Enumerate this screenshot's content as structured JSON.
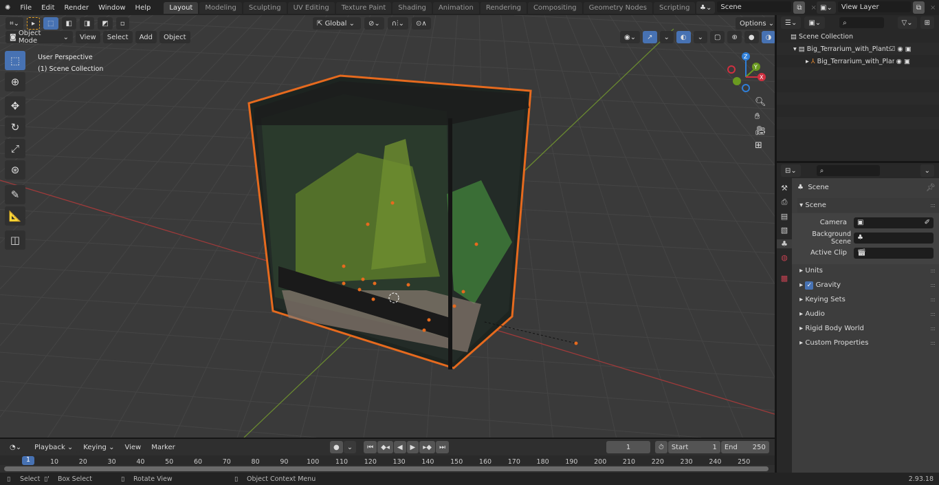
{
  "menu": [
    "File",
    "Edit",
    "Render",
    "Window",
    "Help"
  ],
  "workspaces": [
    "Layout",
    "Modeling",
    "Sculpting",
    "UV Editing",
    "Texture Paint",
    "Shading",
    "Animation",
    "Rendering",
    "Compositing",
    "Geometry Nodes",
    "Scripting"
  ],
  "active_workspace": "Layout",
  "scene_field": "Scene",
  "view_layer_field": "View Layer",
  "header": {
    "transform_orientation": "Global",
    "options": "Options",
    "mode": "Object Mode",
    "menus": [
      "View",
      "Select",
      "Add",
      "Object"
    ]
  },
  "viewport": {
    "perspective": "User Perspective",
    "collection": "(1) Scene Collection",
    "accent": "#e66a1e"
  },
  "tools": [
    "select-box",
    "cursor",
    "move",
    "rotate",
    "scale",
    "transform",
    "annotate",
    "measure",
    "add-cube"
  ],
  "outliner": {
    "root": "Scene Collection",
    "items": [
      {
        "label": "Big_Terrarium_with_Plants_ar",
        "type": "collection"
      },
      {
        "label": "Big_Terrarium_with_Plant",
        "type": "empty"
      }
    ]
  },
  "properties": {
    "context": "Scene",
    "panel": "Scene",
    "fields": [
      {
        "label": "Camera",
        "value": ""
      },
      {
        "label": "Background Scene",
        "value": ""
      },
      {
        "label": "Active Clip",
        "value": ""
      }
    ],
    "subpanels": [
      "Units",
      "Gravity",
      "Keying Sets",
      "Audio",
      "Rigid Body World",
      "Custom Properties"
    ],
    "gravity_checked": true
  },
  "timeline": {
    "menus": [
      "Playback",
      "Keying",
      "View",
      "Marker"
    ],
    "current_frame": "1",
    "start_label": "Start",
    "start": "1",
    "end_label": "End",
    "end": "250",
    "ticks": [
      "10",
      "20",
      "30",
      "40",
      "50",
      "60",
      "70",
      "80",
      "90",
      "100",
      "110",
      "120",
      "130",
      "140",
      "150",
      "160",
      "170",
      "180",
      "190",
      "200",
      "210",
      "220",
      "230",
      "240",
      "250"
    ]
  },
  "status": {
    "items": [
      "Select",
      "Box Select",
      "Rotate View",
      "Object Context Menu"
    ],
    "version": "2.93.18"
  }
}
